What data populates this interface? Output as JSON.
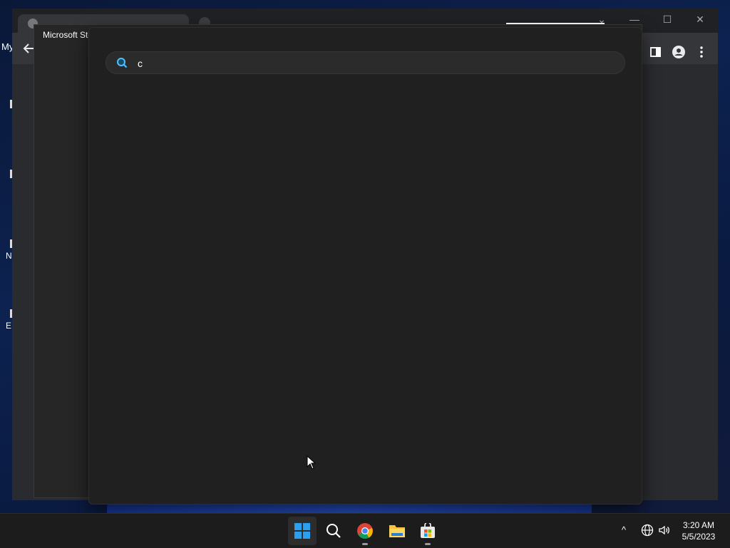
{
  "desktop": {
    "partial_label": "My",
    "icon_letters": [
      "N",
      "E"
    ]
  },
  "chrome": {
    "min_label": "—",
    "max_label": "☐",
    "close_label": "✕"
  },
  "store": {
    "title": "Microsoft Store"
  },
  "search": {
    "value": "c",
    "placeholder": ""
  },
  "taskbar": {
    "apps": [
      "start",
      "search",
      "chrome",
      "file-explorer",
      "microsoft-store"
    ],
    "tray_chevron": "^",
    "time": "3:20 AM",
    "date": "5/5/2023"
  },
  "colors": {
    "windows_blue": "#2aa0f0",
    "store_bg": "#262626",
    "flyout_bg": "#202020"
  }
}
